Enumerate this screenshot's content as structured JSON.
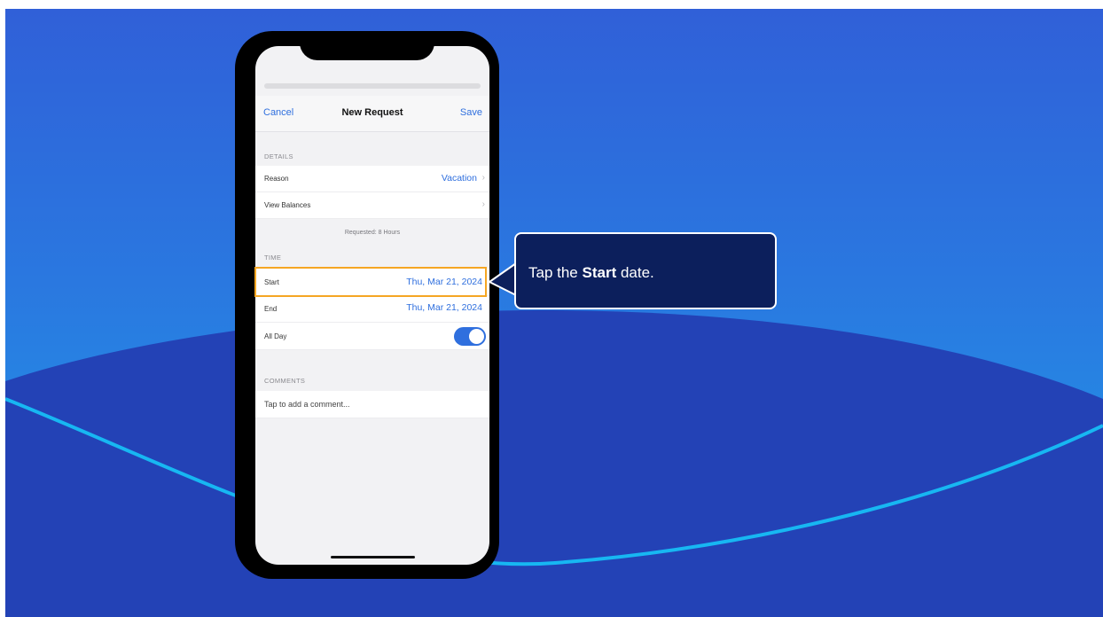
{
  "colors": {
    "accent": "#2f6fde",
    "highlight": "#f5a623",
    "callout_bg": "#0c1f5c",
    "toggle_on": "#2f6fde"
  },
  "nav": {
    "cancel": "Cancel",
    "title": "New Request",
    "save": "Save"
  },
  "details": {
    "header": "DETAILS",
    "reason_label": "Reason",
    "reason_value": "Vacation",
    "balances_label": "View Balances",
    "requested": "Requested: 8 Hours"
  },
  "time": {
    "header": "TIME",
    "start_label": "Start",
    "start_value": "Thu, Mar 21, 2024",
    "end_label": "End",
    "end_value": "Thu, Mar 21, 2024",
    "allday_label": "All Day",
    "allday_on": true
  },
  "comments": {
    "header": "COMMENTS",
    "placeholder": "Tap to add a comment..."
  },
  "callout": {
    "prefix": "Tap the ",
    "bold": "Start",
    "suffix": " date."
  },
  "icons": {
    "chevron": "chevron-right-icon"
  }
}
